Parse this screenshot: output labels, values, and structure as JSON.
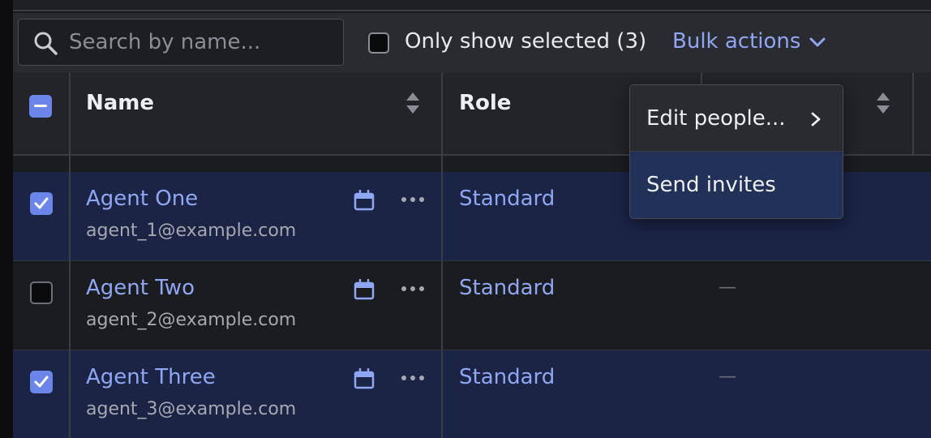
{
  "toolbar": {
    "search_placeholder": "Search by name...",
    "only_show_selected_label": "Only show selected (3)",
    "only_show_selected_checked": false,
    "bulk_actions_label": "Bulk actions"
  },
  "table": {
    "select_all_state": "indeterminate",
    "columns": [
      {
        "label": "Name",
        "sortable": true
      },
      {
        "label": "Role",
        "sortable": false
      },
      {
        "label": "",
        "sortable": true
      }
    ],
    "rows": [
      {
        "name": "Agent One",
        "email": "agent_1@example.com",
        "role": "Standard",
        "third": "",
        "selected": true
      },
      {
        "name": "Agent Two",
        "email": "agent_2@example.com",
        "role": "Standard",
        "third": "—",
        "selected": false
      },
      {
        "name": "Agent Three",
        "email": "agent_3@example.com",
        "role": "Standard",
        "third": "—",
        "selected": true
      }
    ]
  },
  "bulk_menu": {
    "items": [
      {
        "label": "Edit people...",
        "has_submenu": true,
        "highlighted": false
      },
      {
        "label": "Send invites",
        "has_submenu": false,
        "highlighted": true
      }
    ]
  },
  "colors": {
    "accent": "#6b86e8",
    "link": "#8fa6f2",
    "selected_row_bg": "#1c2446",
    "menu_highlight": "#223158"
  },
  "icons": [
    "search-icon",
    "chevron-down-icon",
    "sort-icon",
    "calendar-icon",
    "more-horizontal-icon",
    "chevron-right-icon",
    "checkmark-icon"
  ]
}
